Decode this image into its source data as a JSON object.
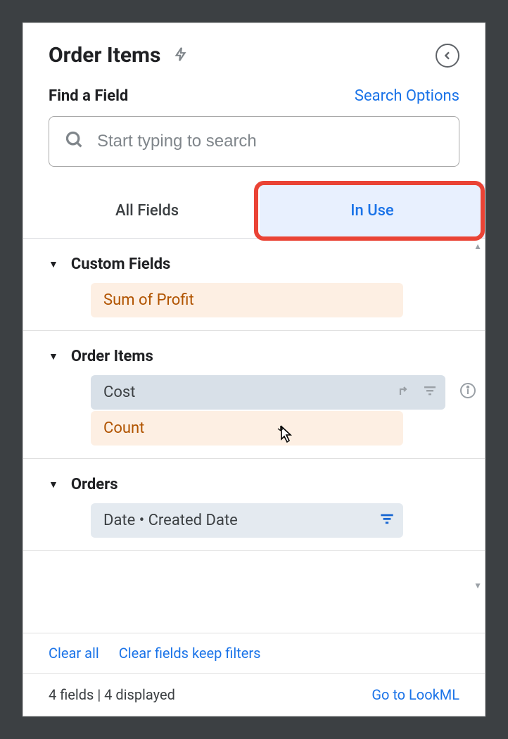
{
  "header": {
    "title": "Order Items"
  },
  "search": {
    "find_label": "Find a Field",
    "options_label": "Search Options",
    "placeholder": "Start typing to search"
  },
  "tabs": {
    "all": "All Fields",
    "in_use": "In Use"
  },
  "sections": [
    {
      "title": "Custom Fields",
      "fields": [
        {
          "label": "Sum of Profit",
          "style": "orange"
        }
      ]
    },
    {
      "title": "Order Items",
      "fields": [
        {
          "label": "Cost",
          "style": "blue-hover"
        },
        {
          "label": "Count",
          "style": "orange"
        }
      ]
    },
    {
      "title": "Orders",
      "fields": [
        {
          "label": "Date • Created Date",
          "style": "blue"
        }
      ]
    }
  ],
  "bottom": {
    "clear_all": "Clear all",
    "clear_keep": "Clear fields keep filters"
  },
  "footer": {
    "status": "4 fields | 4 displayed",
    "lookml": "Go to LookML"
  }
}
